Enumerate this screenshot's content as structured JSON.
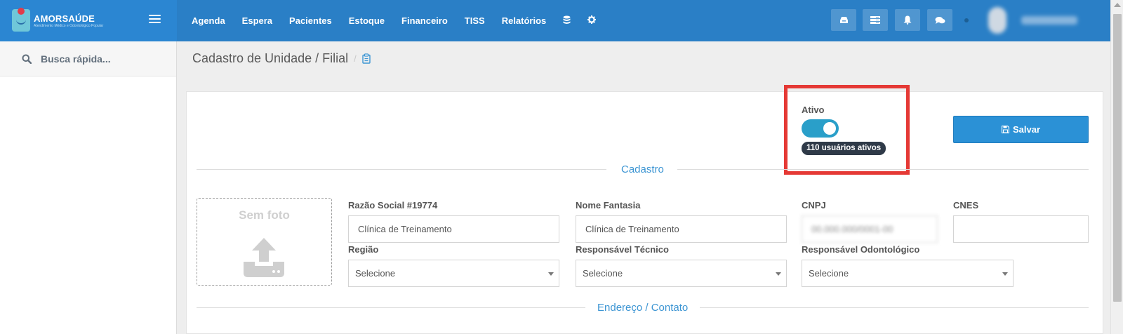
{
  "brand": {
    "name": "AMORSAÚDE",
    "subtitle": "Atendimento Médico e Odontológico Popular"
  },
  "nav": {
    "items": [
      "Agenda",
      "Espera",
      "Pacientes",
      "Estoque",
      "Financeiro",
      "TISS",
      "Relatórios"
    ],
    "icons": [
      "database-icon",
      "gear-icon"
    ]
  },
  "toolbar": {
    "icons": [
      "inbox-icon",
      "list-icon",
      "bell-icon",
      "chat-icon"
    ],
    "user_name": "User Name"
  },
  "sidebar": {
    "search_label": "Busca rápida..."
  },
  "breadcrumb": {
    "title": "Cadastro de Unidade / Filial",
    "separator": "/"
  },
  "form": {
    "ativo_label": "Ativo",
    "ativo_on": true,
    "active_users_badge": "110 usuários ativos",
    "save_label": "Salvar",
    "section_cadastro": "Cadastro",
    "section_endereco": "Endereço / Contato",
    "photo_label": "Sem foto",
    "fields": {
      "razao_social": {
        "label": "Razão Social #19774",
        "value": "Clínica de Treinamento"
      },
      "nome_fantasia": {
        "label": "Nome Fantasia",
        "value": "Clínica de Treinamento"
      },
      "cnpj": {
        "label": "CNPJ",
        "value": "00.000.000/0001-00"
      },
      "cnes": {
        "label": "CNES",
        "value": ""
      },
      "regiao": {
        "label": "Região",
        "value": "Selecione"
      },
      "responsavel_tecnico": {
        "label": "Responsável Técnico",
        "value": "Selecione"
      },
      "responsavel_odonto": {
        "label": "Responsável Odontológico",
        "value": "Selecione"
      }
    }
  },
  "colors": {
    "navbar": "#2a7fc6",
    "brand_bg": "#2b86d2",
    "accent": "#3c95d3",
    "toggle_on": "#2a9fc9",
    "badge_bg": "#2f3a48",
    "highlight": "#e53935"
  }
}
